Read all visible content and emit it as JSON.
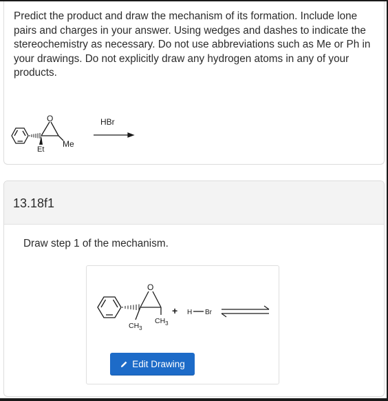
{
  "question": {
    "text": "Predict the product and draw the mechanism of its formation. Include lone pairs and charges in your answer. Using wedges and dashes to indicate the stereochemistry as necessary. Do not use abbreviations such as Me or Ph in your drawings. Do not explicitly draw any hydrogen atoms in any of your products."
  },
  "scheme": {
    "oxygen": "O",
    "ethyl": "Et",
    "methyl": "Me",
    "reagent": "HBr"
  },
  "part": {
    "label": "13.18f1",
    "instruction": "Draw step 1 of the mechanism."
  },
  "drawing": {
    "oxygen": "O",
    "methyl_1": "CH",
    "methyl_1_sub": "3",
    "methyl_2": "CH",
    "methyl_2_sub": "3",
    "plus": "+",
    "h": "H",
    "br": "Br",
    "edit_button": "Edit Drawing"
  }
}
